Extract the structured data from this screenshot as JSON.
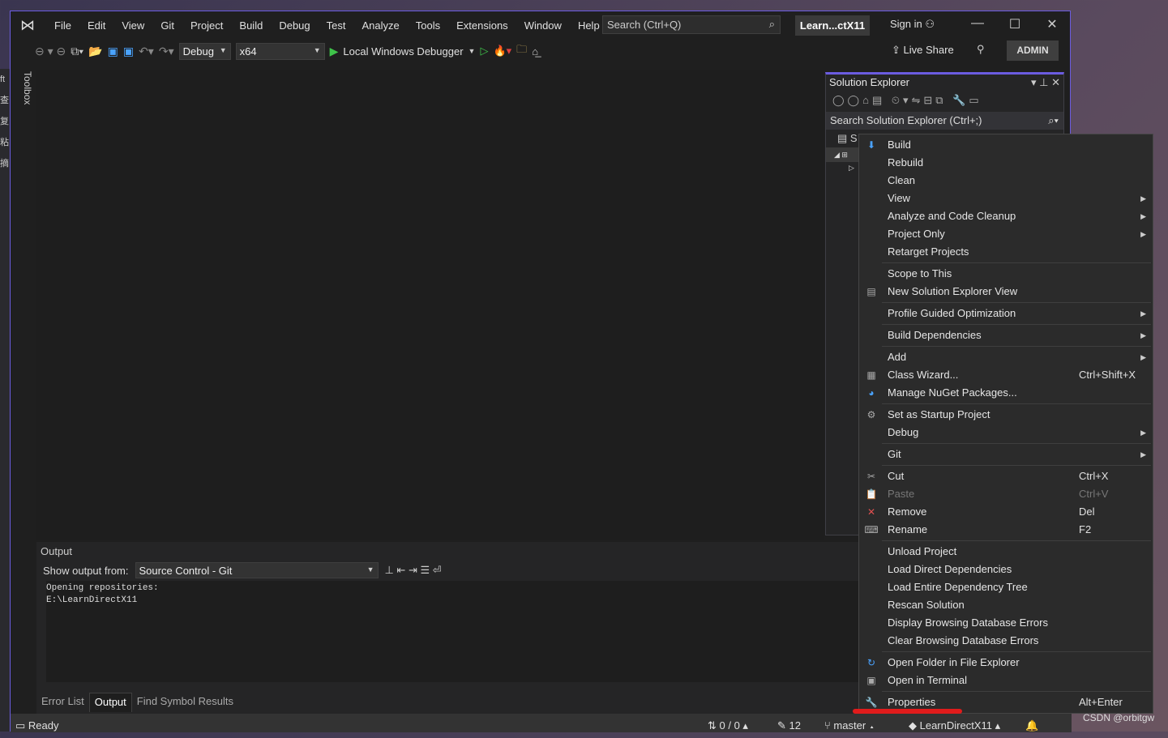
{
  "left_strip": [
    "ft",
    "查",
    "复",
    "粘",
    "摘"
  ],
  "menubar": {
    "items": [
      "File",
      "Edit",
      "View",
      "Git",
      "Project",
      "Build",
      "Debug",
      "Test",
      "Analyze",
      "Tools",
      "Extensions",
      "Window",
      "Help"
    ],
    "search_placeholder": "Search (Ctrl+Q)",
    "project_name": "Learn...ctX11",
    "sign_in": "Sign in"
  },
  "toolbar": {
    "config": "Debug",
    "platform": "x64",
    "run_label": "Local Windows Debugger",
    "live_share": "Live Share",
    "admin": "ADMIN"
  },
  "toolbox_label": "Toolbox",
  "solution_explorer": {
    "title": "Solution Explorer",
    "search_placeholder": "Search Solution Explorer (Ctrl+;)",
    "tree_first": "S"
  },
  "context_menu": {
    "groups": [
      [
        {
          "label": "Build",
          "icon": "build-icon"
        },
        {
          "label": "Rebuild"
        },
        {
          "label": "Clean"
        },
        {
          "label": "View",
          "sub": true
        },
        {
          "label": "Analyze and Code Cleanup",
          "sub": true
        },
        {
          "label": "Project Only",
          "sub": true
        },
        {
          "label": "Retarget Projects"
        }
      ],
      [
        {
          "label": "Scope to This"
        },
        {
          "label": "New Solution Explorer View",
          "icon": "new-view-icon"
        }
      ],
      [
        {
          "label": "Profile Guided Optimization",
          "sub": true
        }
      ],
      [
        {
          "label": "Build Dependencies",
          "sub": true
        }
      ],
      [
        {
          "label": "Add",
          "sub": true
        },
        {
          "label": "Class Wizard...",
          "shortcut": "Ctrl+Shift+X",
          "icon": "class-wizard-icon"
        },
        {
          "label": "Manage NuGet Packages...",
          "icon": "nuget-icon"
        }
      ],
      [
        {
          "label": "Set as Startup Project",
          "icon": "gear-icon"
        },
        {
          "label": "Debug",
          "sub": true
        }
      ],
      [
        {
          "label": "Git",
          "sub": true
        }
      ],
      [
        {
          "label": "Cut",
          "shortcut": "Ctrl+X",
          "icon": "scissors-icon"
        },
        {
          "label": "Paste",
          "shortcut": "Ctrl+V",
          "icon": "paste-icon",
          "disabled": true
        },
        {
          "label": "Remove",
          "shortcut": "Del",
          "icon": "close-icon"
        },
        {
          "label": "Rename",
          "shortcut": "F2",
          "icon": "rename-icon"
        }
      ],
      [
        {
          "label": "Unload Project"
        },
        {
          "label": "Load Direct Dependencies"
        },
        {
          "label": "Load Entire Dependency Tree"
        },
        {
          "label": "Rescan Solution"
        },
        {
          "label": "Display Browsing Database Errors"
        },
        {
          "label": "Clear Browsing Database Errors"
        }
      ],
      [
        {
          "label": "Open Folder in File Explorer",
          "icon": "refresh-folder-icon"
        },
        {
          "label": "Open in Terminal",
          "icon": "terminal-icon"
        }
      ],
      [
        {
          "label": "Properties",
          "shortcut": "Alt+Enter",
          "icon": "wrench-icon"
        }
      ]
    ]
  },
  "output": {
    "title": "Output",
    "show_from_label": "Show output from:",
    "source": "Source Control - Git",
    "lines": [
      "Opening repositories:",
      "E:\\LearnDirectX11"
    ],
    "tabs": [
      "Error List",
      "Output",
      "Find Symbol Results"
    ],
    "active_tab": "Output"
  },
  "status": {
    "ready": "Ready",
    "sync": "0 / 0",
    "changes": "12",
    "branch": "master",
    "repo": "LearnDirectX11"
  },
  "watermark": "CSDN @orbitgw",
  "colors": {
    "accent": "#6b5ce0",
    "highlight": "#e01b1b"
  }
}
